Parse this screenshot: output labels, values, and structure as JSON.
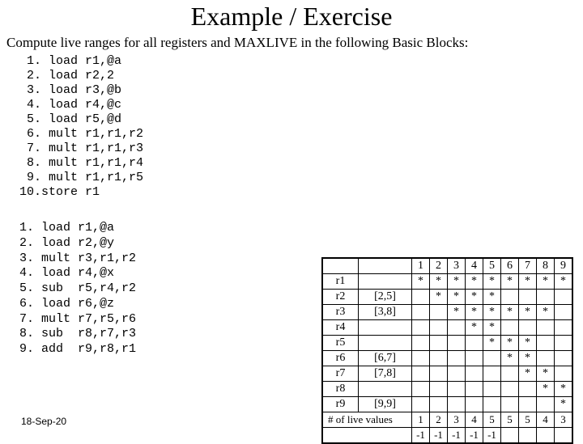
{
  "title": "Example / Exercise",
  "subtitle": "Compute live ranges for all registers and MAXLIVE in the following Basic Blocks:",
  "code1": " 1. load r1,@a\n 2. load r2,2\n 3. load r3,@b\n 4. load r4,@c\n 5. load r5,@d\n 6. mult r1,r1,r2\n 7. mult r1,r1,r3\n 8. mult r1,r1,r4\n 9. mult r1,r1,r5\n10.store r1",
  "code2": "1. load r1,@a\n2. load r2,@y\n3. mult r3,r1,r2\n4. load r4,@x\n5. sub  r5,r4,r2\n6. load r6,@z\n7. mult r7,r5,r6\n8. sub  r8,r7,r3\n9. add  r9,r8,r1",
  "footer": "18-Sep-20",
  "chart_data": {
    "type": "table",
    "columns": [
      1,
      2,
      3,
      4,
      5,
      6,
      7,
      8,
      9
    ],
    "rows": [
      {
        "reg": "r1",
        "range": "",
        "marks": [
          "*",
          "*",
          "*",
          "*",
          "*",
          "*",
          "*",
          "*",
          "*"
        ]
      },
      {
        "reg": "r2",
        "range": "[2,5]",
        "marks": [
          "",
          "*",
          "*",
          "*",
          "*",
          "",
          "",
          "",
          ""
        ]
      },
      {
        "reg": "r3",
        "range": "[3,8]",
        "marks": [
          "",
          "",
          "*",
          "*",
          "*",
          "*",
          "*",
          "*",
          ""
        ]
      },
      {
        "reg": "r4",
        "range": "",
        "marks": [
          "",
          "",
          "",
          "*",
          "*",
          "",
          "",
          "",
          ""
        ]
      },
      {
        "reg": "r5",
        "range": "",
        "marks": [
          "",
          "",
          "",
          "",
          "*",
          "*",
          "*",
          "",
          ""
        ]
      },
      {
        "reg": "r6",
        "range": "[6,7]",
        "marks": [
          "",
          "",
          "",
          "",
          "",
          "*",
          "*",
          "",
          ""
        ]
      },
      {
        "reg": "r7",
        "range": "[7,8]",
        "marks": [
          "",
          "",
          "",
          "",
          "",
          "",
          "*",
          "*",
          ""
        ]
      },
      {
        "reg": "r8",
        "range": "",
        "marks": [
          "",
          "",
          "",
          "",
          "",
          "",
          "",
          "*",
          "*"
        ]
      },
      {
        "reg": "r9",
        "range": "[9,9]",
        "marks": [
          "",
          "",
          "",
          "",
          "",
          "",
          "",
          "",
          "*"
        ]
      }
    ],
    "live_label": "# of live values",
    "live_values": [
      1,
      2,
      3,
      4,
      5,
      5,
      5,
      4,
      3
    ],
    "bottom_values": [
      "-1",
      "-1",
      "-1",
      "-1",
      "-1",
      "",
      "",
      "",
      ""
    ]
  }
}
